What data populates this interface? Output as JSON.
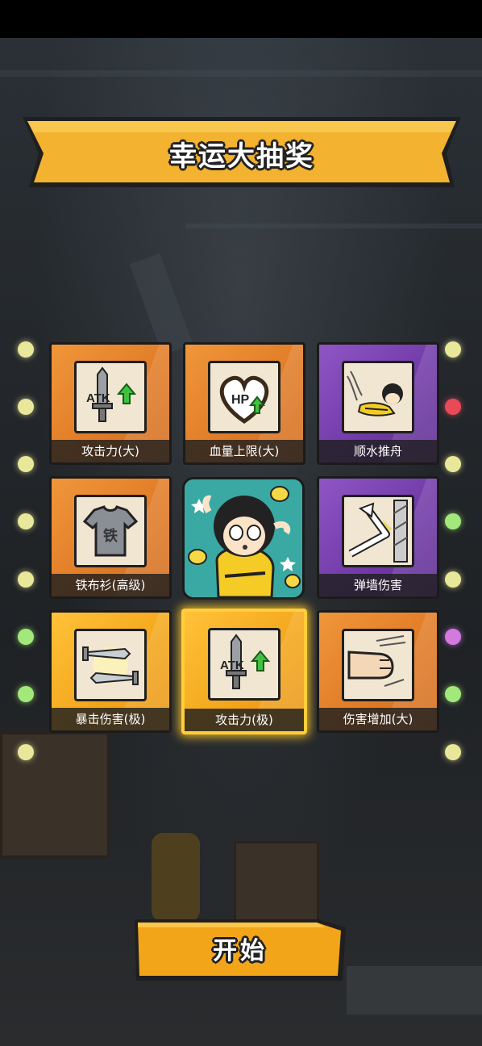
{
  "title": "幸运大抽奖",
  "start_button": "开始",
  "colors": {
    "orange": "#e07a26",
    "purple": "#6f39a6",
    "gold": "#f3a51a",
    "highlight": "#ffce3a",
    "banner": "#f3b22f"
  },
  "cards": [
    {
      "label": "攻击力(大)",
      "icon": "atk-sword-icon",
      "color": "orange"
    },
    {
      "label": "血量上限(大)",
      "icon": "hp-heart-icon",
      "color": "orange"
    },
    {
      "label": "顺水推舟",
      "icon": "sliding-kid-icon",
      "color": "purple"
    },
    {
      "label": "铁布衫(高级)",
      "icon": "iron-shirt-icon",
      "color": "orange"
    },
    {
      "label": "弹墙伤害",
      "icon": "wall-bounce-icon",
      "color": "purple"
    },
    {
      "label": "暴击伤害(极)",
      "icon": "crossed-swords-icon",
      "color": "gold"
    },
    {
      "label": "攻击力(极)",
      "icon": "atk-sword-icon",
      "color": "gold",
      "selected": true
    },
    {
      "label": "伤害增加(大)",
      "icon": "fist-punch-icon",
      "color": "orange"
    }
  ],
  "iron_shirt_char": "铁",
  "atk_text": "ATK",
  "hp_text": "HP"
}
